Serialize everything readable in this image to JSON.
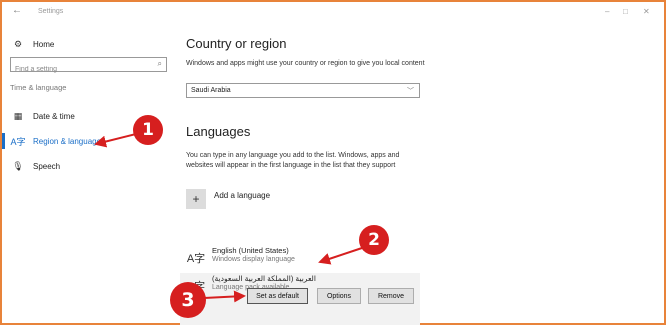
{
  "window": {
    "back_glyph": "←",
    "title": "Settings",
    "minimize_glyph": "–",
    "maximize_glyph": "□",
    "close_glyph": "✕"
  },
  "sidebar": {
    "home_label": "Home",
    "search": {
      "placeholder": "Find a setting"
    },
    "group_label": "Time & language",
    "items": [
      {
        "label": "Date & time",
        "icon": "calendar-icon"
      },
      {
        "label": "Region & language",
        "icon": "region-language-icon",
        "active": true
      },
      {
        "label": "Speech",
        "icon": "microphone-icon"
      }
    ]
  },
  "main": {
    "region_heading": "Country or region",
    "region_description": "Windows and apps might use your country or region to give you local content",
    "region_value": "Saudi Arabia",
    "languages_heading": "Languages",
    "languages_description": "You can type in any language you add to the list. Windows, apps and websites will appear in the first language in the list that they support",
    "add_language_label": "Add a language",
    "languages": [
      {
        "name": "English (United States)",
        "status": "Windows display language"
      },
      {
        "name": "العربية (المملكة العربية السعودية)",
        "status": "Language pack available",
        "selected": true
      }
    ],
    "buttons": {
      "set_default": "Set as default",
      "options": "Options",
      "remove": "Remove"
    }
  },
  "callouts": [
    "1",
    "2",
    "3"
  ],
  "colors": {
    "accent": "#1a6ec7",
    "callout": "#d61f1f",
    "frame": "#e8833a"
  }
}
